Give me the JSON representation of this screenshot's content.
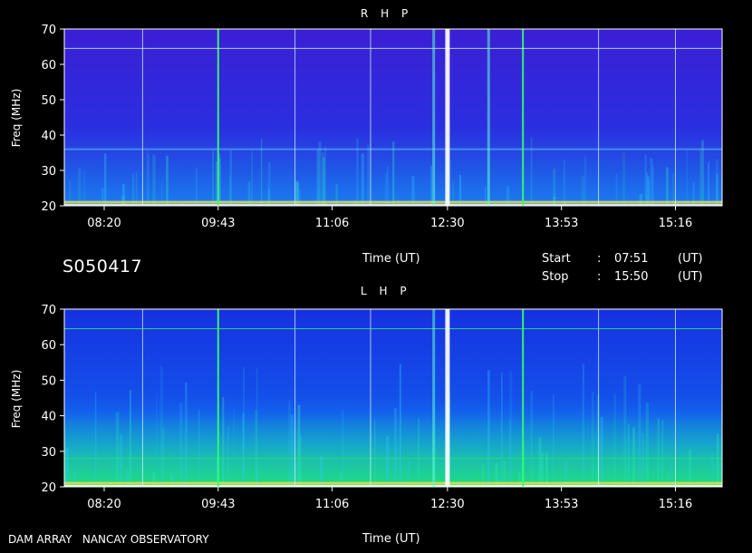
{
  "figure": {
    "file_id": "S050417",
    "footer_left": "DAM ARRAY   NANCAY OBSERVATORY",
    "time_axis_label": "Time (UT)",
    "start_label": "Start",
    "stop_label": "Stop",
    "separator": ":",
    "start_value": "07:51",
    "stop_value": "15:50",
    "unit_label": "(UT)"
  },
  "chart_data": [
    {
      "type": "heatmap",
      "title": "R H P",
      "xlabel": "Time (UT)",
      "ylabel": "Freq (MHz)",
      "x_ticks": [
        "08:20",
        "09:43",
        "11:06",
        "12:30",
        "13:53",
        "15:16"
      ],
      "y_ticks": [
        20,
        30,
        40,
        50,
        60,
        70
      ],
      "x_range": [
        "07:51",
        "15:50"
      ],
      "y_range": [
        20,
        70
      ],
      "grid_times": [
        "08:48",
        "09:43",
        "10:39",
        "11:34",
        "12:30",
        "13:25",
        "14:20",
        "15:16"
      ],
      "grid_freqs": [
        64.5
      ],
      "colors": {
        "background": "#3a22d8",
        "grid": "#d8f4f4",
        "bright_line": "#33ff66"
      },
      "features": [
        {
          "kind": "band",
          "freq": 21,
          "intensity": "high"
        },
        {
          "kind": "band",
          "freq": 36,
          "intensity": "low"
        },
        {
          "kind": "burst",
          "time": "12:30",
          "intensity": "high"
        },
        {
          "kind": "burst",
          "time": "12:20",
          "intensity": "medium"
        },
        {
          "kind": "burst",
          "time": "13:00",
          "intensity": "medium"
        }
      ]
    },
    {
      "type": "heatmap",
      "title": "L H P",
      "xlabel": "Time (UT)",
      "ylabel": "Freq (MHz)",
      "x_ticks": [
        "08:20",
        "09:43",
        "11:06",
        "12:30",
        "13:53",
        "15:16"
      ],
      "y_ticks": [
        20,
        30,
        40,
        50,
        60,
        70
      ],
      "x_range": [
        "07:51",
        "15:50"
      ],
      "y_range": [
        20,
        70
      ],
      "grid_times": [
        "08:48",
        "09:43",
        "10:39",
        "11:34",
        "12:30",
        "13:25",
        "14:20",
        "15:16"
      ],
      "grid_freqs": [
        64.5
      ],
      "colors": {
        "background": "#1838e8",
        "grid": "#d8f4f4",
        "bright_line": "#33ff66"
      },
      "features": [
        {
          "kind": "band",
          "freq": 21,
          "intensity": "high"
        },
        {
          "kind": "band",
          "freq": 28,
          "intensity": "medium"
        },
        {
          "kind": "burst",
          "time": "12:30",
          "intensity": "high"
        },
        {
          "kind": "burst",
          "time": "12:20",
          "intensity": "medium"
        }
      ]
    }
  ]
}
